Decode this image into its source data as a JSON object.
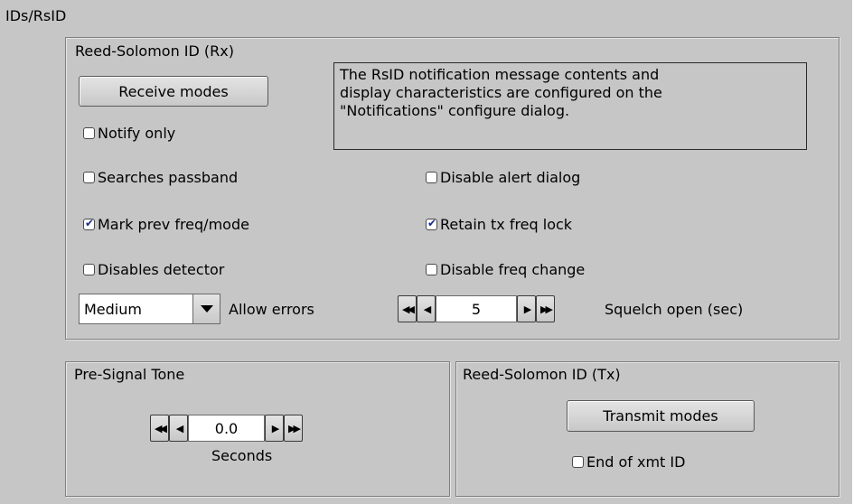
{
  "tab": {
    "label": "IDs/RsID"
  },
  "rx": {
    "title": "Reed-Solomon ID (Rx)",
    "receive_modes_label": "Receive modes",
    "notice_lines": [
      "The RsID notification message contents and",
      "display characteristics are configured on the",
      "\"Notifications\" configure dialog."
    ],
    "notify_only": {
      "label": "Notify only",
      "checked": false
    },
    "searches_passband": {
      "label": "Searches passband",
      "checked": false
    },
    "disable_alert_dialog": {
      "label": "Disable alert dialog",
      "checked": false
    },
    "mark_prev_freq_mode": {
      "label": "Mark prev freq/mode",
      "checked": true
    },
    "retain_tx_freq_lock": {
      "label": "Retain tx freq lock",
      "checked": true
    },
    "disables_detector": {
      "label": "Disables detector",
      "checked": false
    },
    "disable_freq_change": {
      "label": "Disable freq change",
      "checked": false
    },
    "allow_errors": {
      "value": "Medium",
      "label": "Allow errors"
    },
    "squelch": {
      "value": "5",
      "label": "Squelch open (sec)"
    }
  },
  "pre_signal": {
    "title": "Pre-Signal Tone",
    "value": "0.0",
    "unit_label": "Seconds"
  },
  "tx": {
    "title": "Reed-Solomon ID (Tx)",
    "transmit_modes_label": "Transmit modes",
    "end_of_xmt_id": {
      "label": "End of xmt ID",
      "checked": false
    }
  },
  "icons": {
    "checkmark": "✔",
    "dropdown": "triangle-down",
    "fast_back": "◀◀",
    "back": "◀",
    "forward": "▶",
    "fast_forward": "▶▶"
  },
  "colors": {
    "panel_bg": "#c6c6c6",
    "check_mark": "#1b2a8a"
  }
}
